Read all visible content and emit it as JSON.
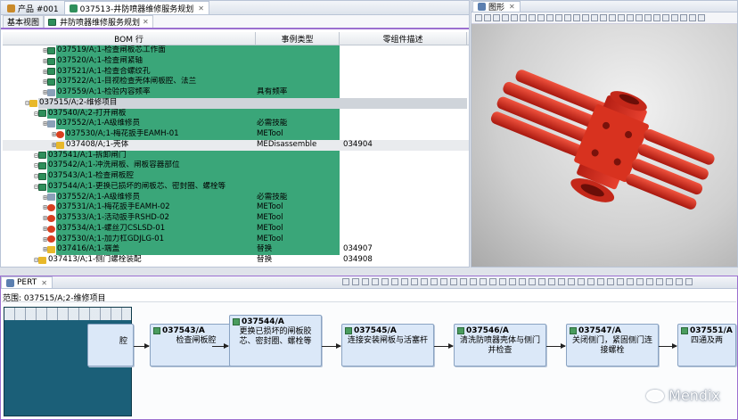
{
  "editor": {
    "tabs": [
      {
        "label": "产品 #001"
      },
      {
        "label": "037513-井防喷器维修服务规划"
      }
    ],
    "subtabs": [
      {
        "label": "基本视图"
      },
      {
        "label": "井防喷器维修服务规划"
      }
    ],
    "columns": {
      "bom_row": "BOM 行",
      "instance_type": "事例类型",
      "part_desc": "零组件描述"
    },
    "rows": [
      {
        "name": "037519/A;1-检查闸板芯工作面",
        "type": "",
        "desc": ""
      },
      {
        "name": "037520/A;1-检查闸紧轴",
        "type": "",
        "desc": ""
      },
      {
        "name": "037521/A;1-检查合螺纹孔",
        "type": "",
        "desc": ""
      },
      {
        "name": "037522/A;1-目视检查壳体闸板腔、法兰",
        "type": "",
        "desc": ""
      },
      {
        "name": "037559/A;1-检验内容频率",
        "type": "具有频率",
        "desc": ""
      },
      {
        "name": "037515/A;2-维修项目",
        "type": "",
        "desc": ""
      },
      {
        "name": "037540/A;2-打开闸板",
        "type": "",
        "desc": ""
      },
      {
        "name": "037552/A;1-A级维修员",
        "type": "必需技能",
        "desc": ""
      },
      {
        "name": "037530/A;1-梅花扳手EAMH-01",
        "type": "METool",
        "desc": ""
      },
      {
        "name": "037408/A;1-壳体",
        "type": "MEDisassemble",
        "desc": "034904"
      },
      {
        "name": "037541/A;1-拆卸闸门",
        "type": "",
        "desc": ""
      },
      {
        "name": "037542/A;1-冲洗闸板、闸板容器部位",
        "type": "",
        "desc": ""
      },
      {
        "name": "037543/A;1-检查闸板腔",
        "type": "",
        "desc": ""
      },
      {
        "name": "037544/A;1-更换已损坏的闸板芯、密封圈、螺栓等",
        "type": "",
        "desc": ""
      },
      {
        "name": "037552/A;1-A级维修员",
        "type": "必需技能",
        "desc": ""
      },
      {
        "name": "037531/A;1-梅花扳手EAMH-02",
        "type": "METool",
        "desc": ""
      },
      {
        "name": "037533/A;1-活动扳手RSHD-02",
        "type": "METool",
        "desc": ""
      },
      {
        "name": "037534/A;1-螺丝刀CSLSD-01",
        "type": "METool",
        "desc": ""
      },
      {
        "name": "037530/A;1-加力杠GDJLG-01",
        "type": "METool",
        "desc": ""
      },
      {
        "name": "037416/A;1-端盖",
        "type": "替换",
        "desc": "034907"
      },
      {
        "name": "037413/A;1-侧门螺栓装配",
        "type": "替换",
        "desc": "034908"
      }
    ]
  },
  "view3d": {
    "tab_label": "图形",
    "colors": {
      "body": "#e23a2a",
      "shade": "#9c1a12"
    }
  },
  "pert": {
    "tab_label": "PERT",
    "scope": "范围: 037515/A;2-维修项目",
    "partial_node_text": "腔",
    "nodes": [
      {
        "id": "037543/A",
        "text": "检查闸板腔"
      },
      {
        "id": "037544/A",
        "text": "更换已损坏的闸板胶芯、密封圈、螺栓等"
      },
      {
        "id": "037545/A",
        "text": "连接安装闸板与活塞杆"
      },
      {
        "id": "037546/A",
        "text": "清洗防喷器壳体与侧门并检查"
      },
      {
        "id": "037547/A",
        "text": "关闭侧门，紧固侧门连接螺栓"
      },
      {
        "id": "037551/A",
        "text": "四通及两"
      }
    ]
  },
  "watermark": "Mendix"
}
